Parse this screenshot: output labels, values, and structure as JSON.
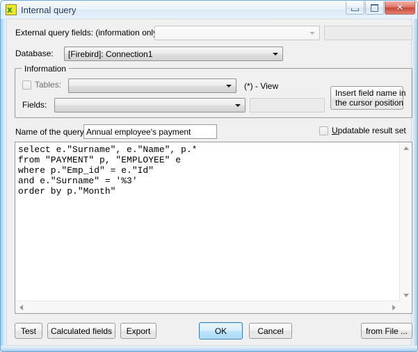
{
  "window": {
    "title": "Internal query",
    "icon": "app-snake-icon",
    "controls": {
      "minimize": "minimize-icon",
      "maximize": "maximize-icon",
      "close": "✕"
    }
  },
  "form": {
    "external_fields": {
      "label": "External query fields: (information only)",
      "combo_value": "",
      "side_value": ""
    },
    "database": {
      "label": "Database:",
      "value": "[Firebird]:  Connection1"
    },
    "information_group": {
      "caption": "Information",
      "tables": {
        "checkbox_label": "Tables:",
        "combo_value": ""
      },
      "view_hint": "(*) - View",
      "fields": {
        "label": "Fields:",
        "combo_value": "",
        "side_value": ""
      },
      "insert_button": {
        "line1": "Insert field name in",
        "line2": "the cursor position"
      }
    },
    "query_name": {
      "label": "Name of the query:",
      "value": "Annual employee's payment",
      "placeholder": ""
    },
    "updatable": {
      "accel": "U",
      "rest": "pdatable result set"
    }
  },
  "editor": {
    "sql": "select e.\"Surname\", e.\"Name\", p.*\nfrom \"PAYMENT\" p, \"EMPLOYEE\" e\nwhere p.\"Emp_id\" = e.\"Id\"\nand e.\"Surname\" = '%3'\norder by p.\"Month\""
  },
  "footer": {
    "test": "Test",
    "calculated_fields": "Calculated fields",
    "export": "Export",
    "ok": "OK",
    "cancel": "Cancel",
    "from_file": "from File ..."
  },
  "colors": {
    "accent": "#3c7fb1",
    "default_button": "#bee6fd",
    "close_button": "#c9493a",
    "dialog_bg": "#f0f0f0",
    "frame": "#9fc9e8"
  }
}
